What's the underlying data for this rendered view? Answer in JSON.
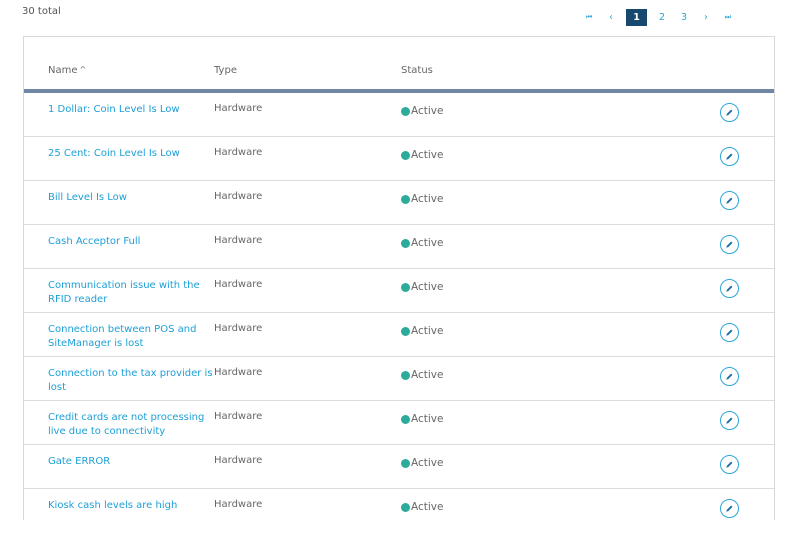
{
  "summary": {
    "total_label": "30 total"
  },
  "pagination": {
    "first_icon": "first-page-icon",
    "prev_icon": "prev-page-icon",
    "next_icon": "next-page-icon",
    "last_icon": "last-page-icon",
    "first_glyph": "⏮",
    "prev_glyph": "‹",
    "next_glyph": "›",
    "last_glyph": "⏭",
    "pages": [
      "1",
      "2",
      "3"
    ],
    "current_page": "1"
  },
  "table": {
    "headers": {
      "name": "Name",
      "name_sort": "^",
      "type": "Type",
      "status": "Status"
    },
    "rows": [
      {
        "name": "1 Dollar: Coin Level Is Low",
        "type": "Hardware",
        "status": "Active"
      },
      {
        "name": "25 Cent: Coin Level Is Low",
        "type": "Hardware",
        "status": "Active"
      },
      {
        "name": "Bill Level Is Low",
        "type": "Hardware",
        "status": "Active"
      },
      {
        "name": "Cash Acceptor Full",
        "type": "Hardware",
        "status": "Active"
      },
      {
        "name": "Communication issue with the RFID reader",
        "type": "Hardware",
        "status": "Active"
      },
      {
        "name": "Connection between POS and SiteManager is lost",
        "type": "Hardware",
        "status": "Active"
      },
      {
        "name": "Connection to the tax provider is lost",
        "type": "Hardware",
        "status": "Active"
      },
      {
        "name": "Credit cards are not processing live due to connectivity",
        "type": "Hardware",
        "status": "Active"
      },
      {
        "name": "Gate ERROR",
        "type": "Hardware",
        "status": "Active"
      },
      {
        "name": "Kiosk cash levels are high",
        "type": "Hardware",
        "status": "Active"
      }
    ]
  },
  "colors": {
    "link": "#1c9fd6",
    "active_dot": "#2bab99",
    "current_page_bg": "#17496f",
    "header_rule": "#6f87a5"
  }
}
